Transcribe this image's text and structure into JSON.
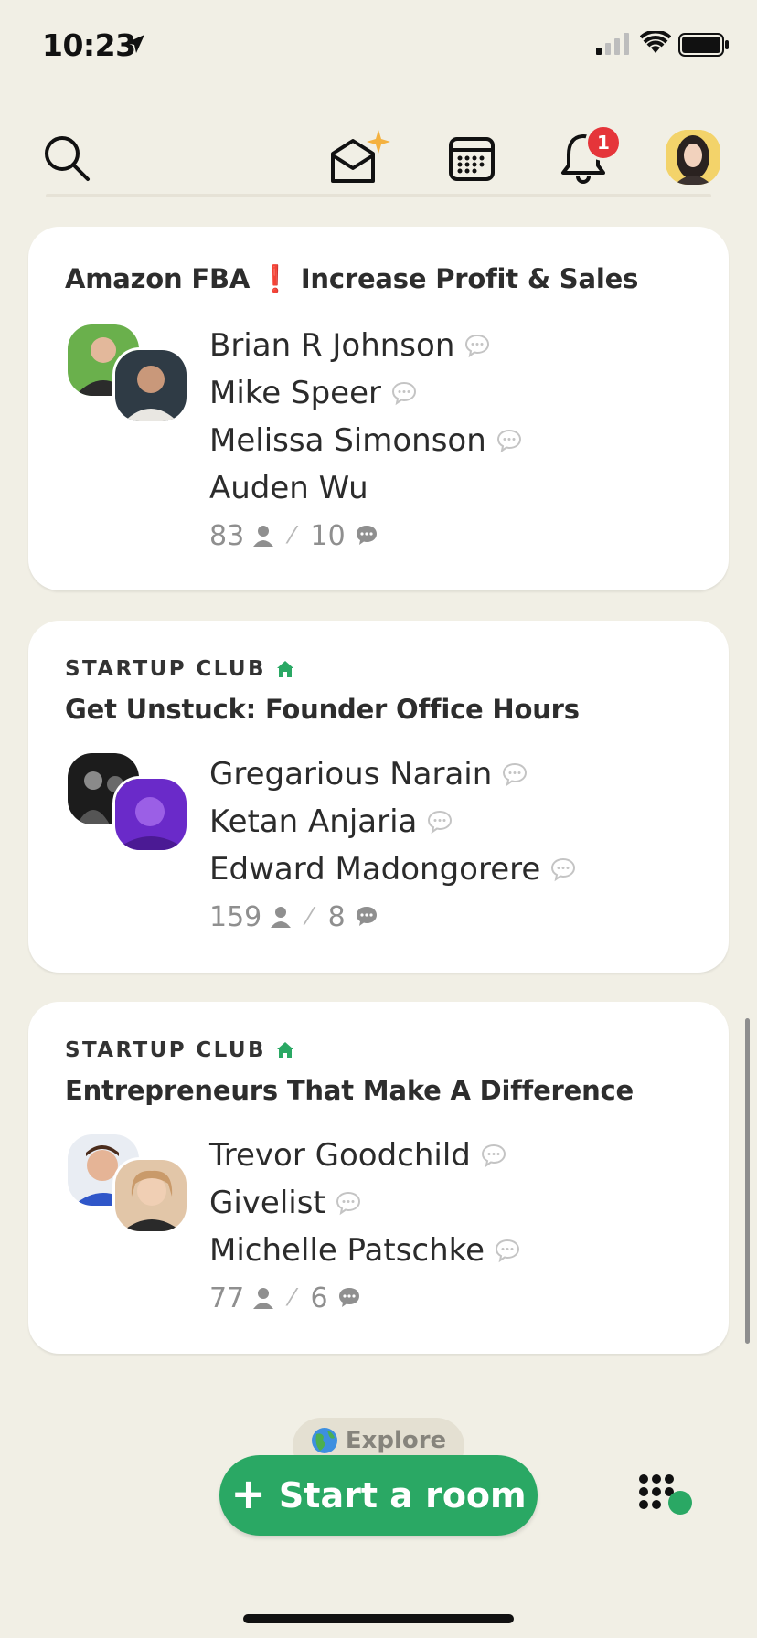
{
  "status_bar": {
    "time": "10:23"
  },
  "notifications": {
    "badge_count": "1"
  },
  "rooms": [
    {
      "club": "",
      "title": "Amazon FBA ❗ Increase Profit & Sales",
      "speakers": [
        "Brian R Johnson",
        "Mike Speer",
        "Melissa Simonson",
        "Auden Wu"
      ],
      "listeners": "83",
      "speaker_count": "10"
    },
    {
      "club": "STARTUP CLUB",
      "title": "Get Unstuck: Founder Office Hours",
      "speakers": [
        "Gregarious Narain",
        "Ketan Anjaria",
        "Edward Madongorere"
      ],
      "listeners": "159",
      "speaker_count": "8"
    },
    {
      "club": "STARTUP CLUB",
      "title": "Entrepreneurs That Make A Difference",
      "speakers": [
        "Trevor Goodchild",
        "Givelist",
        "Michelle Patschke"
      ],
      "listeners": "77",
      "speaker_count": "6"
    }
  ],
  "bottom": {
    "explore_label": "Explore",
    "start_room_label": "Start a room"
  },
  "colors": {
    "background": "#f1efe5",
    "accent_green": "#2aa864",
    "badge_red": "#e5353a"
  }
}
